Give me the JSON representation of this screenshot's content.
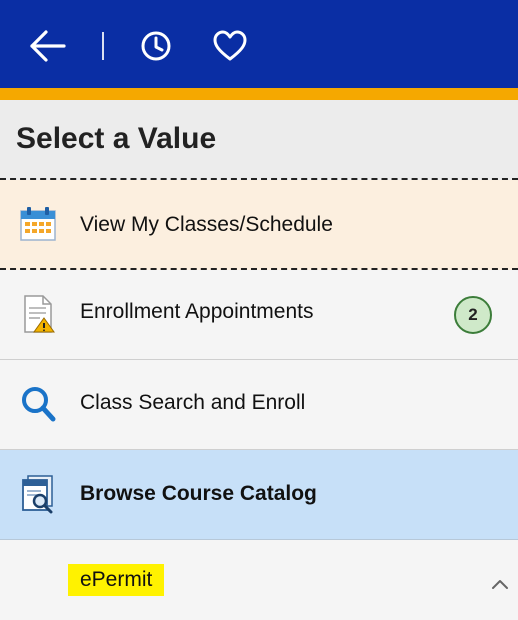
{
  "header": {
    "back_icon": "arrow-left-icon",
    "history_icon": "clock-icon",
    "favorites_icon": "heart-icon",
    "colors": {
      "bar": "#0a2ea4",
      "accent": "#f5a800"
    }
  },
  "title": "Select a Value",
  "items": [
    {
      "label": "View My Classes/Schedule",
      "icon": "calendar-icon",
      "state": "focused"
    },
    {
      "label": "Enrollment Appointments",
      "icon": "document-warning-icon",
      "badge": "2"
    },
    {
      "label": "Class Search and Enroll",
      "icon": "magnifier-icon"
    },
    {
      "label": "Browse Course Catalog",
      "icon": "catalog-search-icon",
      "state": "selected"
    },
    {
      "label": "ePermit",
      "icon": "chevron-up-icon",
      "state": "expanded",
      "highlight": "#fff200"
    }
  ]
}
